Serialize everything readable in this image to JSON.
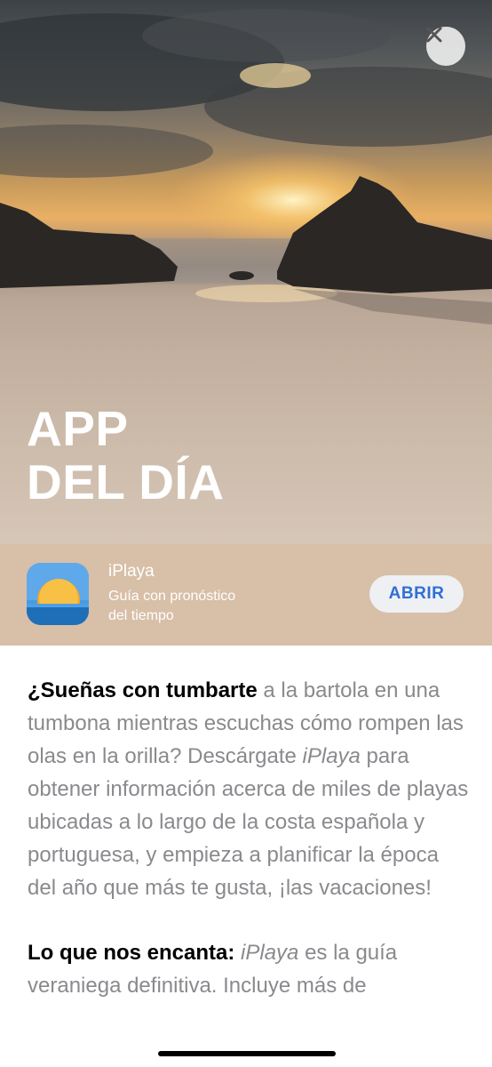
{
  "hero": {
    "title_line1": "APP",
    "title_line2": "DEL DÍA"
  },
  "close_icon": "close-icon",
  "app": {
    "name": "iPlaya",
    "subtitle_line1": "Guía con pronóstico",
    "subtitle_line2": "del tiempo",
    "open_label": "ABRIR",
    "icon": "sun-over-sea-icon"
  },
  "article": {
    "p1_bold": "¿Sueñas con tumbarte",
    "p1_a": " a la bartola en una tumbona mientras escuchas cómo rompen las olas en la orilla? Descárgate ",
    "p1_italic": "iPlaya",
    "p1_b": " para obtener información acerca de miles de playas ubicadas a lo largo de la costa española y portuguesa, y empieza a planificar la época del año que más te gusta, ¡las vacaciones!",
    "p2_bold": "Lo que nos encanta:",
    "p2_space": " ",
    "p2_italic": "iPlaya",
    "p2_a": " es la guía veraniega definitiva. Incluye más de"
  },
  "colors": {
    "accent": "#2f6fd6",
    "strip": "#d8bfa8"
  }
}
